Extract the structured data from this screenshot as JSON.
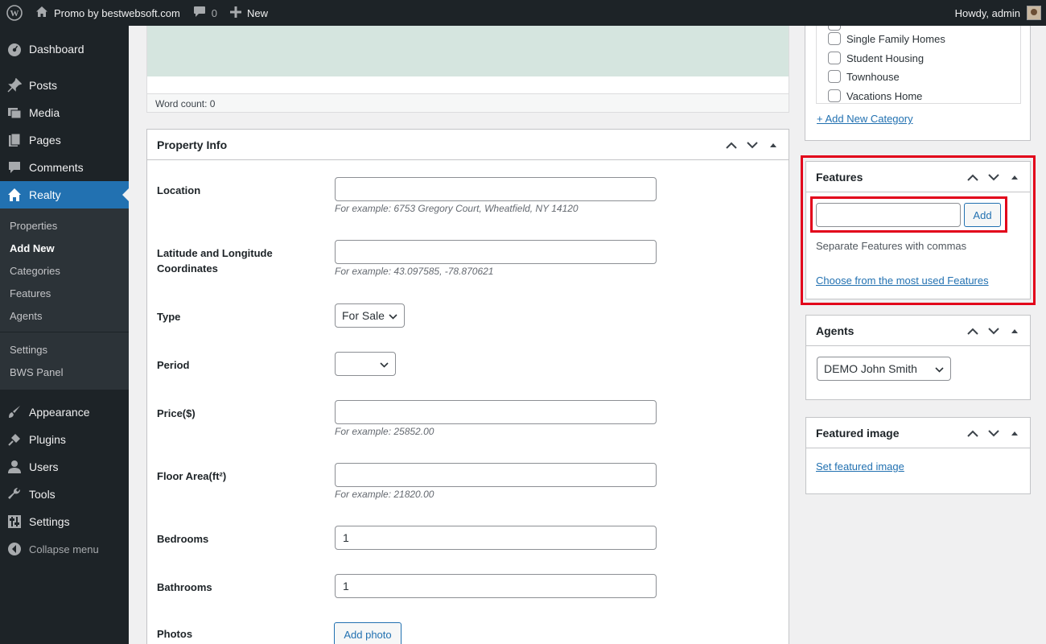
{
  "adminbar": {
    "site_name": "Promo by bestwebsoft.com",
    "comments_count": "0",
    "new_label": "New",
    "howdy": "Howdy, admin"
  },
  "sidebar": {
    "dashboard": "Dashboard",
    "posts": "Posts",
    "media": "Media",
    "pages": "Pages",
    "comments": "Comments",
    "realty": "Realty",
    "submenu": [
      "Properties",
      "Add New",
      "Categories",
      "Features",
      "Agents",
      "Settings",
      "BWS Panel"
    ],
    "appearance": "Appearance",
    "plugins": "Plugins",
    "users": "Users",
    "tools": "Tools",
    "settings": "Settings",
    "collapse": "Collapse menu"
  },
  "editor": {
    "word_count": "Word count: 0"
  },
  "property_info": {
    "title": "Property Info",
    "location_label": "Location",
    "location_hint": "For example: 6753 Gregory Court, Wheatfield, NY 14120",
    "coords_label_1": "Latitude and Longitude",
    "coords_label_2": "Coordinates",
    "coords_hint": "For example: 43.097585, -78.870621",
    "type_label": "Type",
    "type_value": "For Sale",
    "period_label": "Period",
    "period_value": "",
    "price_label": "Price($)",
    "price_hint": "For example: 25852.00",
    "floor_label": "Floor Area(ft²)",
    "floor_hint": "For example: 21820.00",
    "bedrooms_label": "Bedrooms",
    "bedrooms_value": "1",
    "bathrooms_label": "Bathrooms",
    "bathrooms_value": "1",
    "photos_label": "Photos",
    "add_photo": "Add photo"
  },
  "categories": {
    "items": [
      "Single Family Homes",
      "Student Housing",
      "Townhouse",
      "Vacations Home"
    ],
    "add_new": "+ Add New Category"
  },
  "features": {
    "title": "Features",
    "input_value": "",
    "add_button": "Add",
    "help": "Separate Features with commas",
    "most_used": "Choose from the most used Features",
    "highlight_color": "#e2001a"
  },
  "agents": {
    "title": "Agents",
    "selected": "DEMO John Smith"
  },
  "featured_image": {
    "title": "Featured image",
    "set_link": "Set featured image"
  },
  "colors": {
    "admin_dark": "#1d2327",
    "accent": "#2271b1",
    "submenu_bg": "#2c3338"
  }
}
